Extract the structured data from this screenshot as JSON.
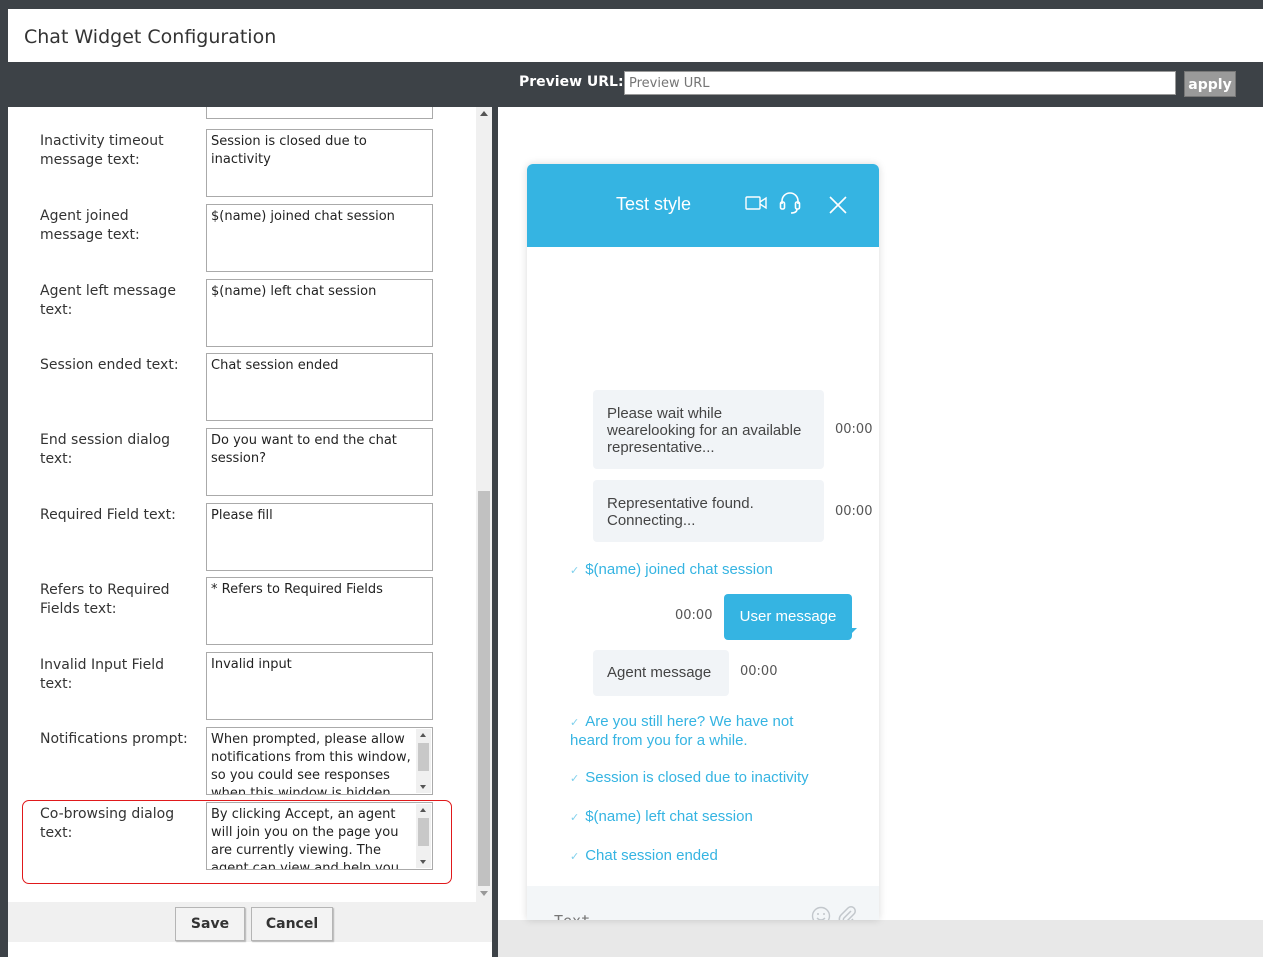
{
  "window": {
    "title": "Chat Widget Configuration"
  },
  "form": {
    "fields": [
      {
        "label": "Inactivity timeout message text:",
        "value": "Session is closed due to inactivity"
      },
      {
        "label": "Agent joined message text:",
        "value": "$(name) joined chat session"
      },
      {
        "label": "Agent left message text:",
        "value": "$(name) left chat session"
      },
      {
        "label": "Session ended text:",
        "value": "Chat session ended"
      },
      {
        "label": "End session dialog text:",
        "value": "Do you want to end the chat session?"
      },
      {
        "label": "Required Field text:",
        "value": "Please fill"
      },
      {
        "label": "Refers to Required Fields text:",
        "value": "* Refers to Required Fields"
      },
      {
        "label": "Invalid Input Field text:",
        "value": "Invalid input"
      },
      {
        "label": "Notifications prompt:",
        "value": "When prompted, please allow notifications from this window, so you could see responses when this window is hidden"
      },
      {
        "label": "Co-browsing dialog text:",
        "value": "By clicking Accept, an agent will join you on the page you are currently viewing. The agent can view and help you as you"
      }
    ],
    "save_label": "Save",
    "cancel_label": "Cancel"
  },
  "preview": {
    "label": "Preview URL:",
    "placeholder": "Preview URL",
    "apply_label": "apply"
  },
  "widget": {
    "title": "Test style",
    "accent_color": "#35b4e2",
    "header_icons": [
      "video-icon",
      "headset-icon",
      "close-icon"
    ],
    "messages": {
      "wait": "Please wait while wearelooking for an available representative...",
      "wait_time": "00:00",
      "found": "Representative found. Connecting...",
      "found_time": "00:00",
      "joined": "$(name) joined chat session",
      "user": "User message",
      "user_time": "00:00",
      "agent": "Agent message",
      "agent_time": "00:00",
      "still_here": "Are you still here? We have not heard from you for a while.",
      "inactive": "Session is closed due to inactivity",
      "left": "$(name) left chat session",
      "ended": "Chat session ended"
    },
    "input_placeholder": "Text...",
    "input_icons": [
      "emoji-icon",
      "attach-icon"
    ]
  }
}
